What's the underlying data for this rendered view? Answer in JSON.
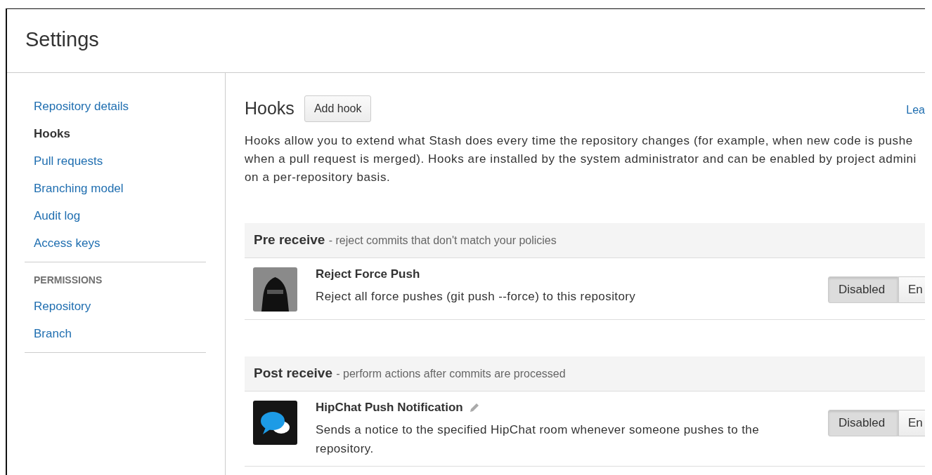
{
  "header": {
    "title": "Settings"
  },
  "sidebar": {
    "items": [
      {
        "label": "Repository details",
        "selected": false
      },
      {
        "label": "Hooks",
        "selected": true
      },
      {
        "label": "Pull requests",
        "selected": false
      },
      {
        "label": "Branching model",
        "selected": false
      },
      {
        "label": "Audit log",
        "selected": false
      },
      {
        "label": "Access keys",
        "selected": false
      }
    ],
    "permissions": {
      "heading": "PERMISSIONS",
      "items": [
        {
          "label": "Repository",
          "selected": false
        },
        {
          "label": "Branch",
          "selected": false
        }
      ]
    }
  },
  "main": {
    "title": "Hooks",
    "add_button": "Add hook",
    "help_link": "Lea",
    "description_lines": [
      "Hooks allow you to extend what Stash does every time the repository changes (for example, when new code is pushe",
      "when a pull request is merged). Hooks are installed by the system administrator and can be enabled by project admini",
      "on a per-repository basis."
    ],
    "sections": [
      {
        "title": "Pre receive",
        "subtitle": "- reject commits that don't match your policies",
        "hooks": [
          {
            "name": "Reject Force Push",
            "editable": false,
            "description": "Reject all force pushes (git push --force) to this repository",
            "toggle": [
              {
                "label": "Disabled",
                "selected": true
              },
              {
                "label": "En",
                "selected": false
              }
            ]
          }
        ]
      },
      {
        "title": "Post receive",
        "subtitle": "- perform actions after commits are processed",
        "hooks": [
          {
            "name": "HipChat Push Notification",
            "editable": true,
            "description": "Sends a notice to the specified HipChat room whenever someone pushes to the repository.",
            "toggle": [
              {
                "label": "Disabled",
                "selected": true
              },
              {
                "label": "En",
                "selected": false
              }
            ]
          }
        ]
      }
    ]
  }
}
